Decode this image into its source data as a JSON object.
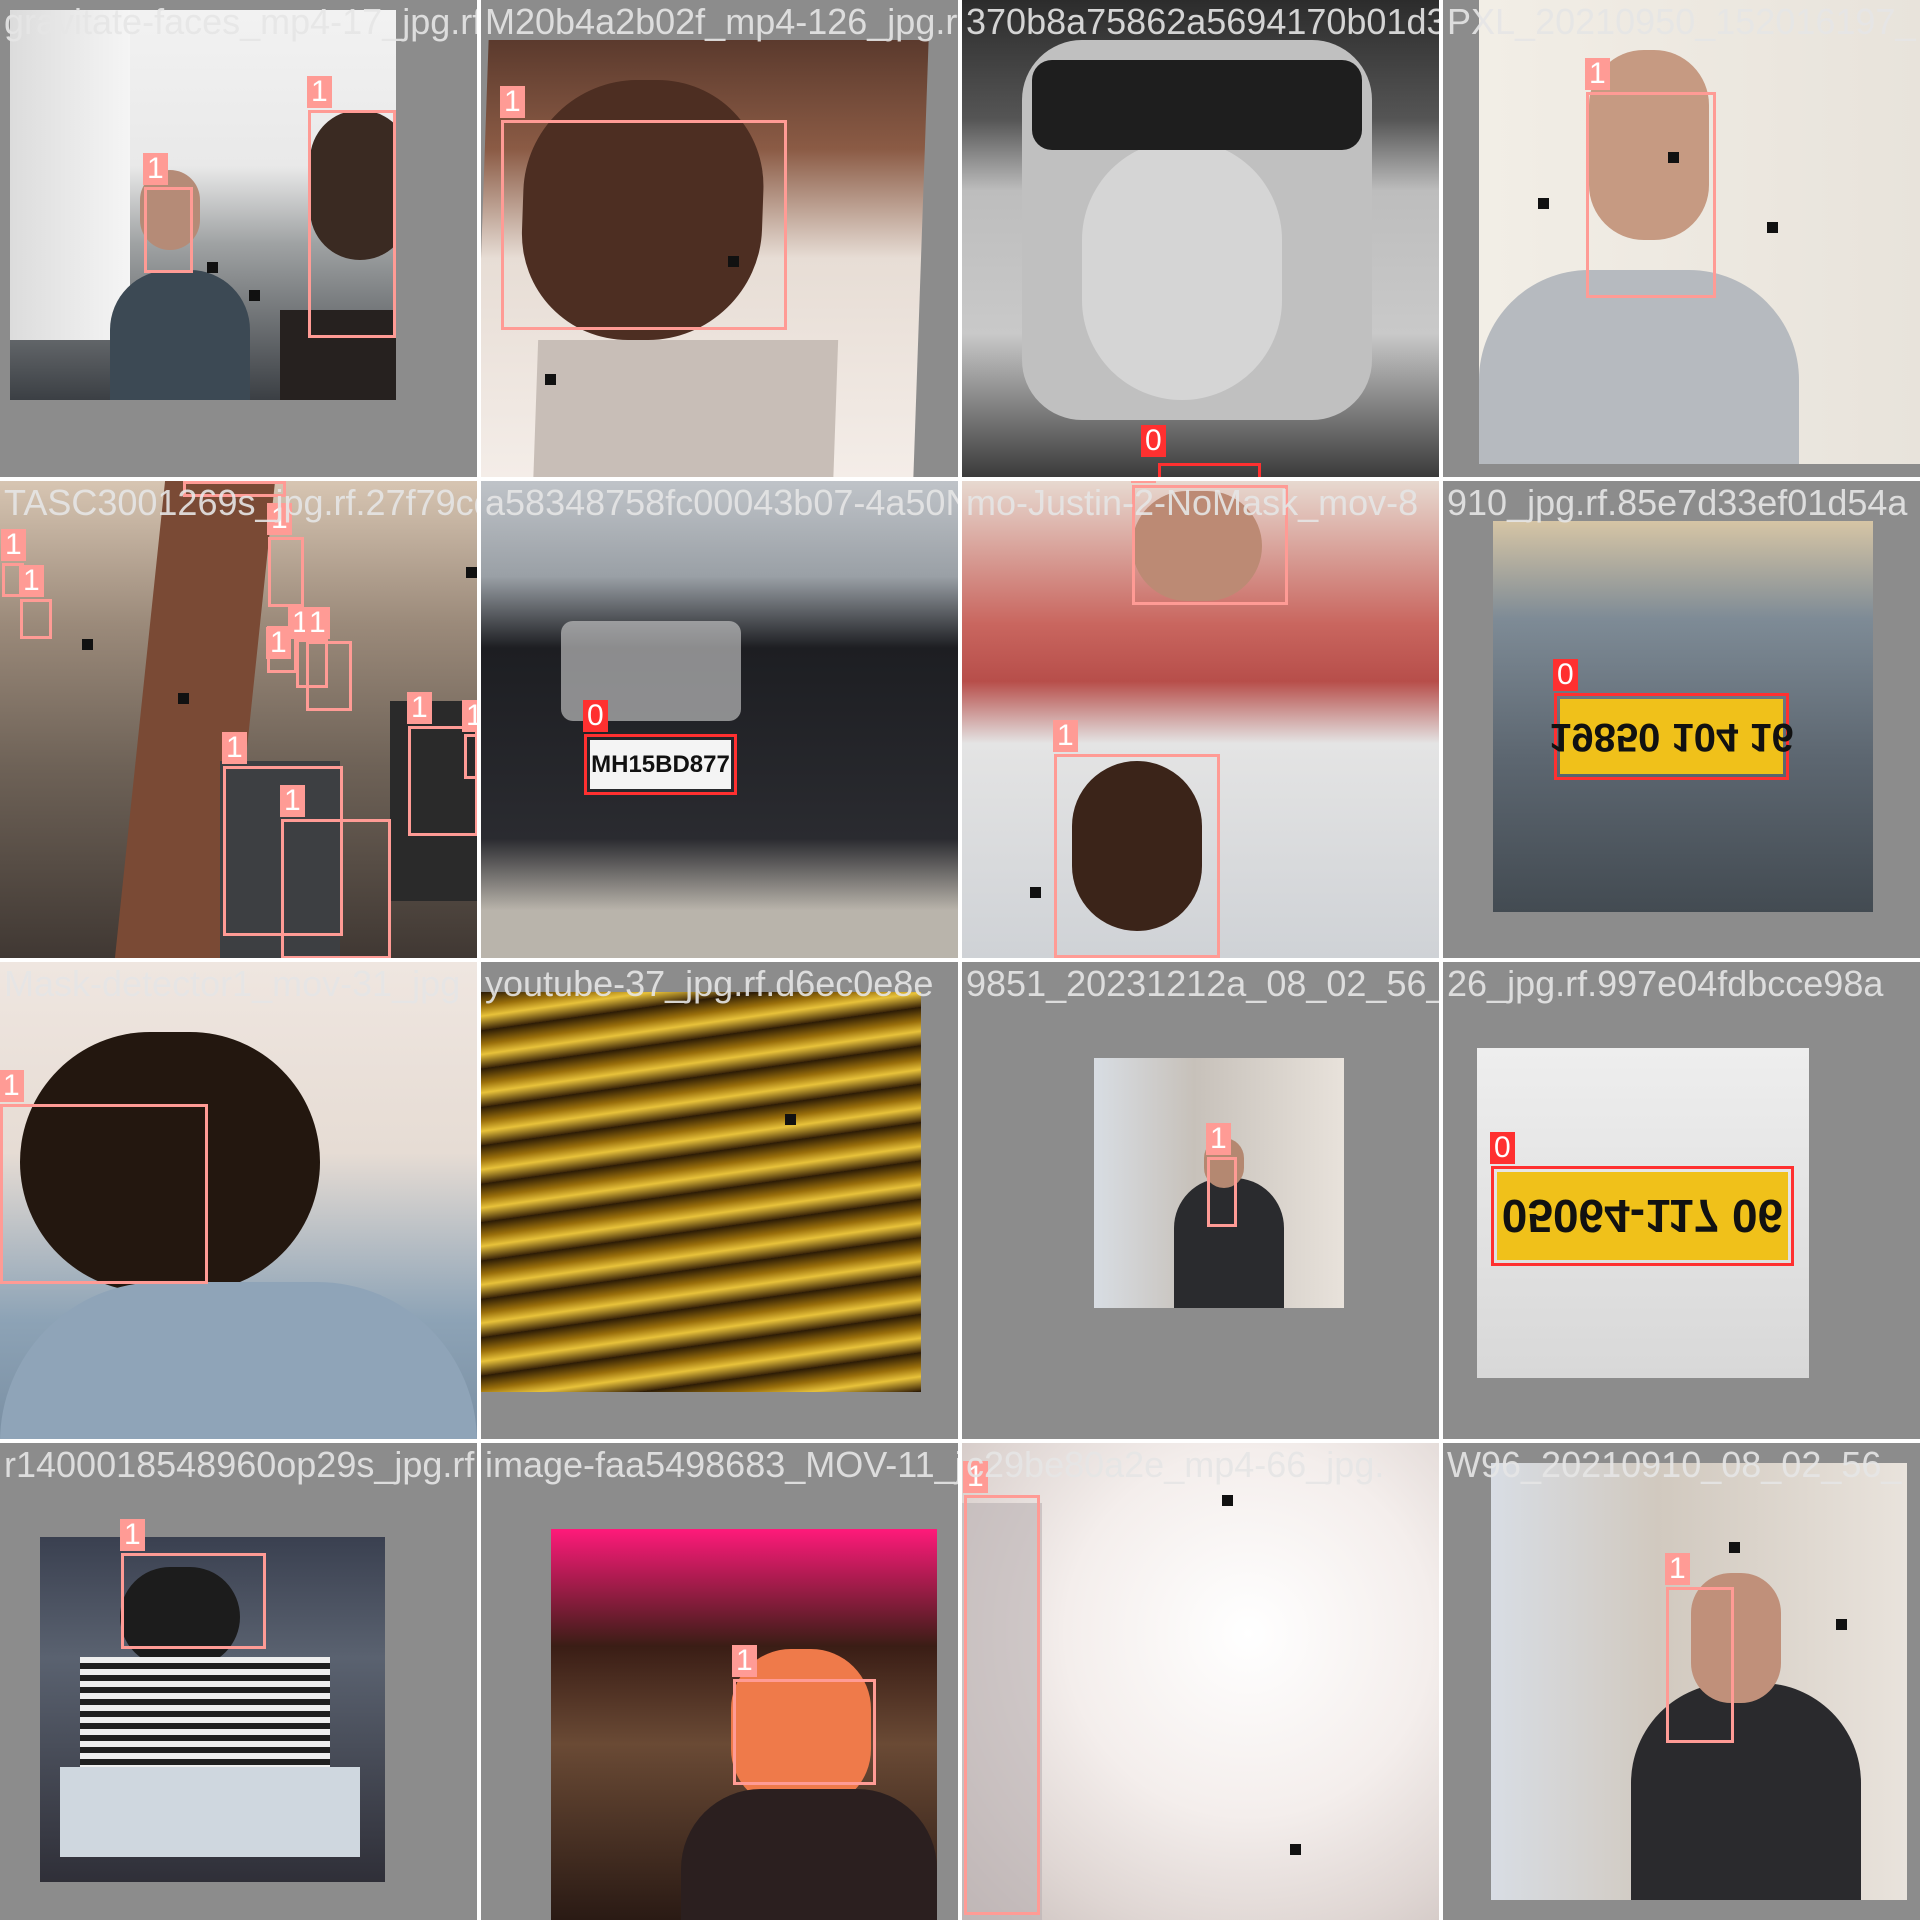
{
  "mosaic": {
    "tiles": [
      {
        "filename": "gravitate-faces_mp4-17_jpg.rf.",
        "labels": [
          "1",
          "1"
        ]
      },
      {
        "filename": "M20b4a2b02f_mp4-126_jpg.rf.",
        "labels": [
          "1"
        ]
      },
      {
        "filename": "370b8a75862a5694170b01d3d",
        "labels": [
          "0"
        ]
      },
      {
        "filename": "PXL_20210950_152016197_",
        "labels": [
          "1"
        ]
      },
      {
        "filename": "TASC3001269s_jpg.rf.27f79cd85b0e",
        "labels": [
          "1",
          "1",
          "1",
          "1",
          "1",
          "1",
          "1",
          "1",
          "1",
          "1",
          "1"
        ]
      },
      {
        "filename": "a58348758fc00043b07-4a50NoMask",
        "labels": [
          "0"
        ]
      },
      {
        "filename": "mo-Justin-2-NoMask_mov-8",
        "labels": [
          "1",
          "1"
        ]
      },
      {
        "filename": "910_jpg.rf.85e7d33ef01d54a",
        "labels": [
          "0"
        ]
      },
      {
        "filename": "Mask-detector1_mov-31_jpg",
        "labels": [
          "1"
        ]
      },
      {
        "filename": "youtube-37_jpg.rf.d6ec0e8e",
        "labels": []
      },
      {
        "filename": "9851_20231212a_08_02_56_",
        "labels": [
          "1"
        ]
      },
      {
        "filename": "26_jpg.rf.997e04fdbcce98a",
        "labels": [
          "0"
        ]
      },
      {
        "filename": "r1400018548960op29s_jpg.rf.",
        "labels": [
          "1"
        ]
      },
      {
        "filename": "image-faa5498683_MOV-11_j",
        "labels": [
          "1"
        ]
      },
      {
        "filename": "c29be80a2e_mp4-66_jpg.",
        "labels": [
          "1"
        ]
      },
      {
        "filename": "W96_20210910_08_02_56_",
        "labels": [
          "1"
        ]
      }
    ],
    "plates": {
      "tile6": "MH15BD877",
      "tile8": "19850 104 16",
      "tile12": "05064-117 06"
    },
    "colors": {
      "face_box": "#ff9b95",
      "plate_box": "#ff3030",
      "padding": "#8c8c8c"
    }
  }
}
